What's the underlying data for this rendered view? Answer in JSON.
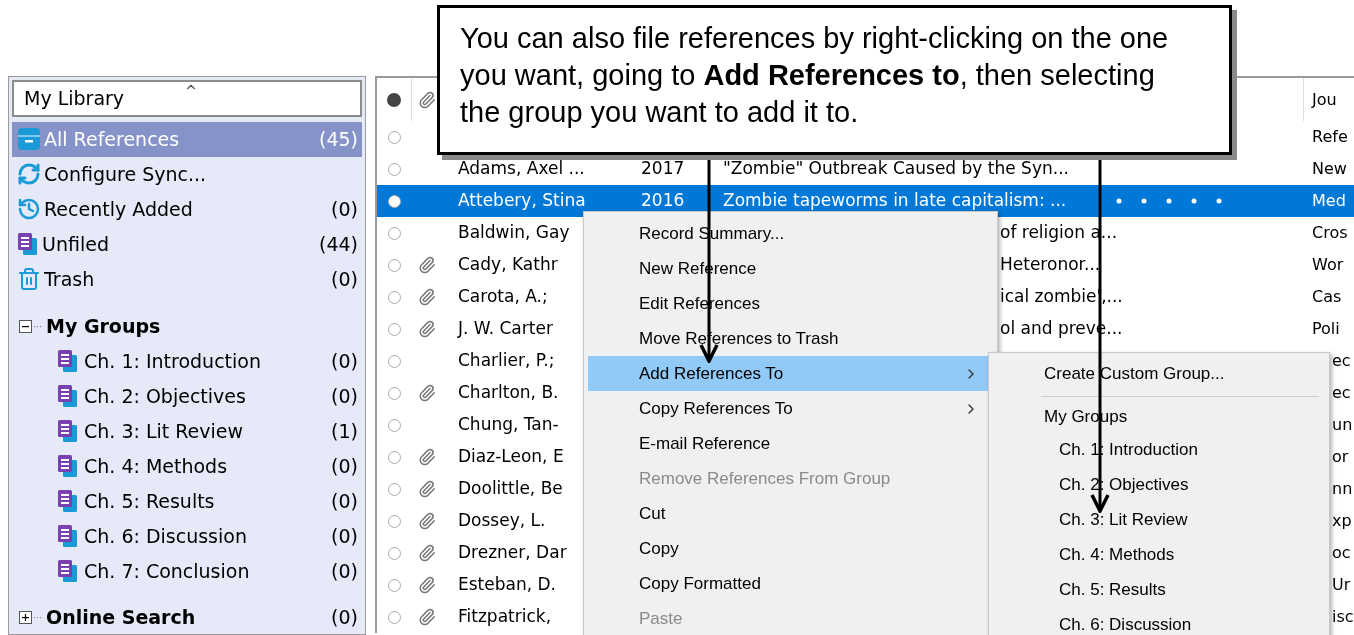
{
  "callout": {
    "text": "You can also file references by right-clicking on the one you want, going to **Add References to**, then selecting the group you want to add it to."
  },
  "sidebar": {
    "library_selector": "My Library",
    "items": [
      {
        "kind": "all",
        "label": "All References",
        "count": "(45)",
        "selected": true
      },
      {
        "kind": "sync",
        "label": "Configure Sync...",
        "selected": false
      },
      {
        "kind": "recent",
        "label": "Recently Added",
        "count": "(0)",
        "selected": false
      },
      {
        "kind": "unfiled",
        "label": "Unfiled",
        "count": "(44)",
        "selected": false
      },
      {
        "kind": "trash",
        "label": "Trash",
        "count": "(0)",
        "selected": false
      }
    ],
    "groups": {
      "label": "My Groups",
      "expanded": true,
      "children": [
        {
          "label": "Ch. 1: Introduction",
          "count": "(0)",
          "selected": false
        },
        {
          "label": "Ch. 2: Objectives",
          "count": "(0)",
          "selected": false
        },
        {
          "label": "Ch. 3: Lit Review",
          "count": "(1)",
          "selected": false
        },
        {
          "label": "Ch. 4: Methods",
          "count": "(0)",
          "selected": false
        },
        {
          "label": "Ch. 5: Results",
          "count": "(0)",
          "selected": false
        },
        {
          "label": "Ch. 6: Discussion",
          "count": "(0)",
          "selected": false
        },
        {
          "label": "Ch. 7: Conclusion",
          "count": "(0)",
          "selected": false
        }
      ]
    },
    "online_search": {
      "label": "Online Search",
      "count": "(0)",
      "expanded": false
    }
  },
  "table": {
    "header": {
      "column_journal": "Jou"
    },
    "rows": [
      {
        "attachment": false,
        "journal": "Refe",
        "selected": false
      },
      {
        "attachment": false,
        "author": "Adams, Axel ...",
        "year": "2017",
        "title": "\"Zombie\" Outbreak Caused by the Syn...",
        "journal": "New",
        "selected": false
      },
      {
        "attachment": false,
        "author": "Attebery, Stina",
        "year": "2016",
        "title": "Zombie tapeworms in late capitalism: ...",
        "journal": "Med",
        "selected": true
      },
      {
        "attachment": false,
        "author": "Baldwin, Gay",
        "title": "of religion a...",
        "partial_title": true,
        "journal": "Cros",
        "selected": false
      },
      {
        "attachment": true,
        "author": "Cady, Kathr",
        "title": "Heteronor...",
        "partial_title": true,
        "journal": "Wor",
        "selected": false
      },
      {
        "attachment": true,
        "author": "Carota, A.;",
        "title": "ical zombie',...",
        "partial_title": true,
        "journal": "Cas",
        "selected": false
      },
      {
        "attachment": true,
        "author": "J. W. Carter",
        "title": "ol and preve...",
        "partial_title": true,
        "journal": "Poli",
        "selected": false
      },
      {
        "attachment": false,
        "author": "Charlier, P.;",
        "journal": "ec",
        "partial_journal": true,
        "selected": false
      },
      {
        "attachment": true,
        "author": "Charlton, B.",
        "journal": "ec",
        "partial_journal": true,
        "selected": false
      },
      {
        "attachment": false,
        "author": "Chung, Tan-",
        "journal": "un",
        "partial_journal": true,
        "selected": false
      },
      {
        "attachment": true,
        "author": "Diaz-Leon, E",
        "journal": "or",
        "partial_journal": true,
        "selected": false
      },
      {
        "attachment": true,
        "author": "Doolittle, Be",
        "journal": "nn",
        "partial_journal": true,
        "selected": false
      },
      {
        "attachment": true,
        "author": "Dossey, L.",
        "journal": "xp",
        "partial_journal": true,
        "selected": false
      },
      {
        "attachment": true,
        "author": "Drezner, Dar",
        "journal": "oc",
        "partial_journal": true,
        "selected": false
      },
      {
        "attachment": true,
        "author": "Esteban, D.",
        "journal": "Ur",
        "partial_journal": true,
        "selected": false
      },
      {
        "attachment": true,
        "author": "Fitzpatrick,",
        "journal": "isc",
        "partial_journal": true,
        "selected": false
      }
    ]
  },
  "context_menu": {
    "items": [
      {
        "label": "Record Summary...",
        "disabled": false,
        "selected": false,
        "submenu": false
      },
      {
        "label": "New Reference",
        "disabled": false,
        "selected": false,
        "submenu": false
      },
      {
        "label": "Edit References",
        "disabled": false,
        "selected": false,
        "submenu": false
      },
      {
        "label": "Move References to Trash",
        "disabled": false,
        "selected": false,
        "submenu": false
      },
      {
        "label": "Add References To",
        "disabled": false,
        "selected": true,
        "submenu": true
      },
      {
        "label": "Copy References To",
        "disabled": false,
        "selected": false,
        "submenu": true
      },
      {
        "label": "E-mail Reference",
        "disabled": false,
        "selected": false,
        "submenu": false
      },
      {
        "label": "Remove References From Group",
        "disabled": true,
        "selected": false,
        "submenu": false
      },
      {
        "label": "Cut",
        "disabled": false,
        "selected": false,
        "submenu": false
      },
      {
        "label": "Copy",
        "disabled": false,
        "selected": false,
        "submenu": false
      },
      {
        "label": "Copy Formatted",
        "disabled": false,
        "selected": false,
        "submenu": false
      },
      {
        "label": "Paste",
        "disabled": true,
        "selected": false,
        "submenu": false
      }
    ]
  },
  "submenu": {
    "create": "Create Custom Group...",
    "section": "My Groups",
    "items": [
      {
        "label": "Ch. 1: Introduction"
      },
      {
        "label": "Ch. 2: Objectives"
      },
      {
        "label": "Ch. 3: Lit Review"
      },
      {
        "label": "Ch. 4: Methods"
      },
      {
        "label": "Ch. 5: Results"
      },
      {
        "label": "Ch. 6: Discussion"
      }
    ]
  }
}
